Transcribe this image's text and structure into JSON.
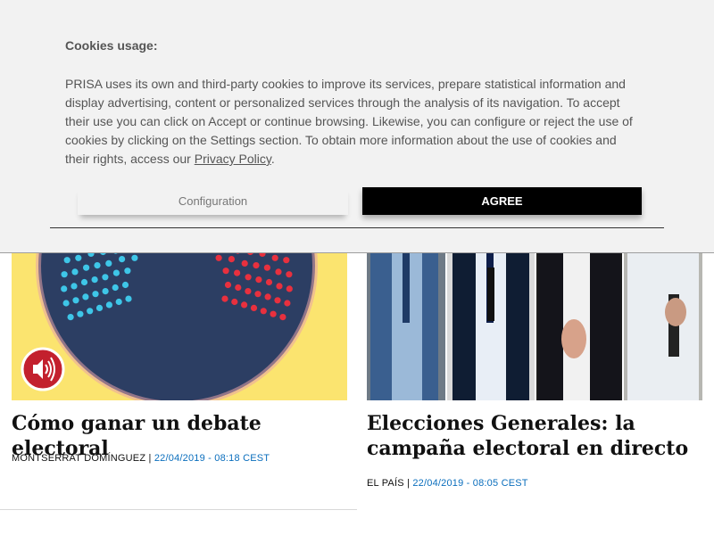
{
  "cookie_banner": {
    "title": "Cookies usage:",
    "text": "PRISA uses its own and third-party cookies to improve its services, prepare statistical information and display advertising, content or personalized services through the analysis of its navigation. To accept their use you can click on Accept or continue browsing. Likewise, you can configure or reject the use of cookies by clicking on the Settings section. To obtain more information about the use of cookies and their rights, access our ",
    "privacy_link": "Privacy Policy",
    "text_end": ".",
    "config_button": "Configuration",
    "agree_button": "AGREE"
  },
  "articles": [
    {
      "headline": "Cómo ganar un debate electoral",
      "author": "Montserrat Domínguez",
      "separator": "|",
      "date": "22/04/2019 - 08:18 CEST",
      "media_icon": "speaker-icon"
    },
    {
      "headline": "Elecciones Generales: la campaña electoral en directo",
      "author": "El País",
      "separator": "|",
      "date": "22/04/2019 - 08:05 CEST"
    }
  ],
  "colors": {
    "banner_bg": "#f2f2f2",
    "agree_bg": "#000000",
    "link_blue": "#0a6ebd",
    "illustration_yellow": "#fbe46f",
    "illustration_navy": "#2c3e63"
  }
}
